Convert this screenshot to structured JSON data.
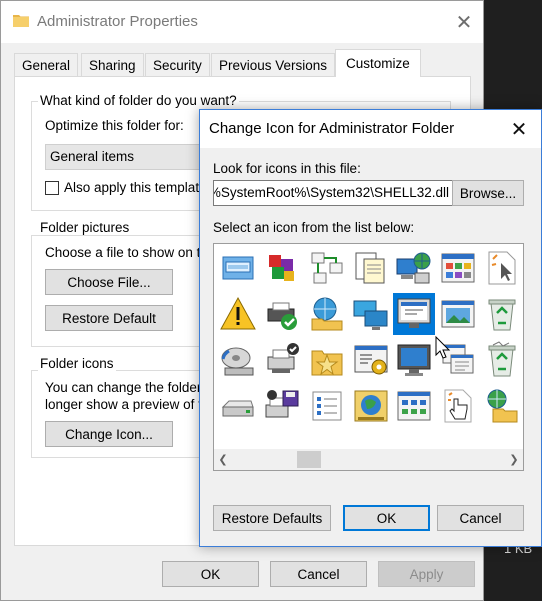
{
  "background_window": {
    "title": "Administrator Properties",
    "close_glyph": "✕",
    "tabs": [
      "General",
      "Sharing",
      "Security",
      "Previous Versions",
      "Customize"
    ],
    "active_tab": "Customize",
    "kind_group": {
      "title": "What kind of folder do you want?",
      "optimize_label": "Optimize this folder for:",
      "optimize_value": "General items",
      "apply_subfolders_label": "Also apply this template"
    },
    "pictures_group": {
      "title": "Folder pictures",
      "description": "Choose a file to show on th",
      "choose_file_label": "Choose File...",
      "restore_default_label": "Restore Default"
    },
    "icons_group": {
      "title": "Folder icons",
      "description_line1": "You can change the folder",
      "description_line2": "longer show a preview of th",
      "change_icon_label": "Change Icon..."
    },
    "footer": {
      "ok_label": "OK",
      "cancel_label": "Cancel",
      "apply_label": "Apply"
    }
  },
  "side_strip": {
    "size_text": "1 KB"
  },
  "dialog": {
    "title": "Change Icon for Administrator Folder",
    "close_glyph": "✕",
    "look_label": "Look for icons in this file:",
    "path_value": "%SystemRoot%\\System32\\SHELL32.dll",
    "browse_label": "Browse...",
    "select_label": "Select an icon from the list below:",
    "icons": [
      "drive-window-icon",
      "cubes-icon",
      "network-diagram-icon",
      "documents-icon",
      "network-globe-icon",
      "control-panel-icon",
      "cursor-page-icon",
      "warning-icon",
      "printer-check-icon",
      "network-globe-folder-icon",
      "network-monitors-icon",
      "monitor-app-icon",
      "image-window-icon",
      "recycle-bin-icon",
      "disc-drive-icon",
      "printer-network-icon",
      "star-folder-icon",
      "settings-window-icon",
      "monitor-icon",
      "windows-stack-icon",
      "recycle-bin-full-icon",
      "drive-icon",
      "printer-floppy-icon",
      "checklist-icon",
      "globe-book-icon",
      "grid-window-icon",
      "hand-pointer-icon",
      "network-folder-icon"
    ],
    "selected_icon": "monitor-app-icon",
    "restore_defaults_label": "Restore Defaults",
    "ok_label": "OK",
    "cancel_label": "Cancel"
  }
}
